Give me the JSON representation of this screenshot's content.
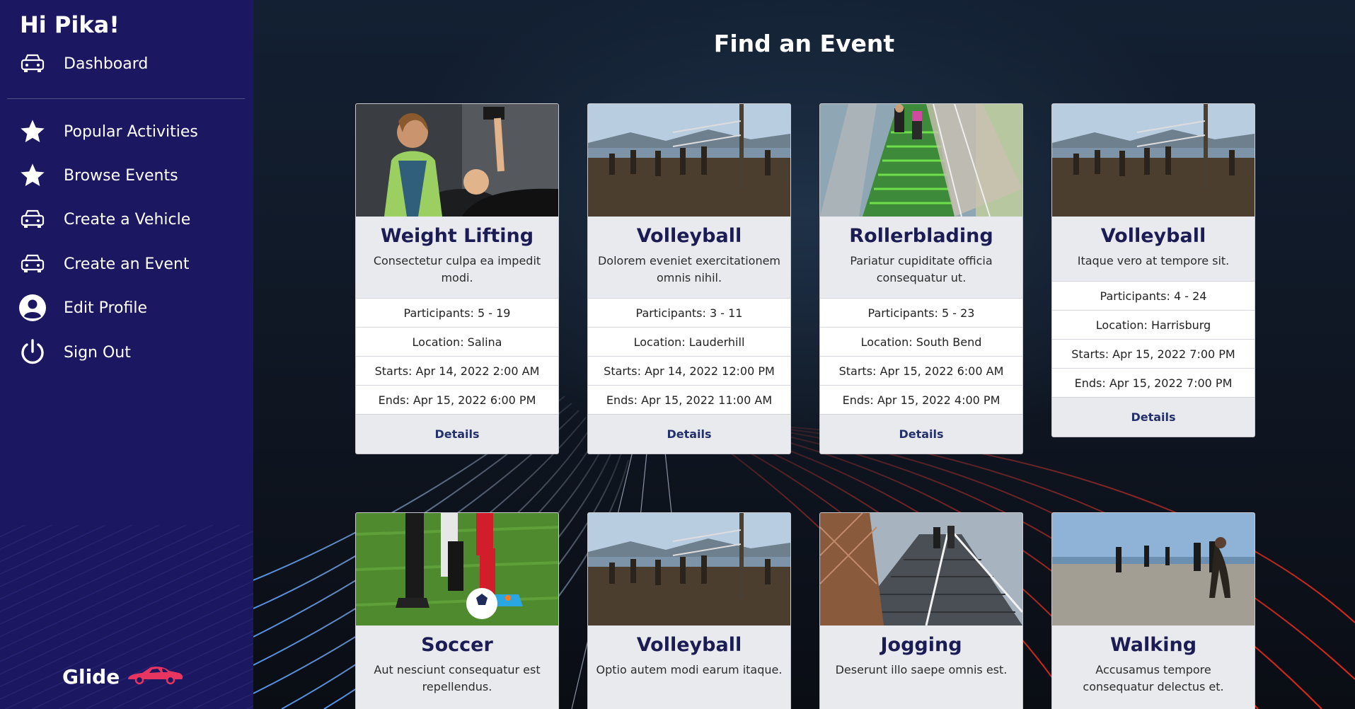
{
  "sidebar": {
    "greeting": "Hi Pika!",
    "items": [
      {
        "label": "Dashboard",
        "icon": "car-icon"
      },
      {
        "label": "Popular Activities",
        "icon": "star-icon"
      },
      {
        "label": "Browse Events",
        "icon": "star-icon"
      },
      {
        "label": "Create a Vehicle",
        "icon": "car-icon"
      },
      {
        "label": "Create an Event",
        "icon": "car-icon"
      },
      {
        "label": "Edit Profile",
        "icon": "user-icon"
      },
      {
        "label": "Sign Out",
        "icon": "power-icon"
      }
    ],
    "brand": "Glide",
    "brand_color": "#e8355f"
  },
  "main": {
    "title": "Find an Event",
    "details_label": "Details",
    "events": [
      {
        "title": "Weight Lifting",
        "description": "Consectetur culpa ea impedit modi.",
        "participants": "Participants: 5 - 19",
        "location": "Location: Salina",
        "starts": "Starts: Apr 14, 2022 2:00 AM",
        "ends": "Ends: Apr 15, 2022 6:00 PM"
      },
      {
        "title": "Volleyball",
        "description": "Dolorem eveniet exercitationem omnis nihil.",
        "participants": "Participants: 3 - 11",
        "location": "Location: Lauderhill",
        "starts": "Starts: Apr 14, 2022 12:00 PM",
        "ends": "Ends: Apr 15, 2022 11:00 AM"
      },
      {
        "title": "Rollerblading",
        "description": "Pariatur cupiditate officia consequatur ut.",
        "participants": "Participants: 5 - 23",
        "location": "Location: South Bend",
        "starts": "Starts: Apr 15, 2022 6:00 AM",
        "ends": "Ends: Apr 15, 2022 4:00 PM"
      },
      {
        "title": "Volleyball",
        "description": "Itaque vero at tempore sit.",
        "participants": "Participants: 4 - 24",
        "location": "Location: Harrisburg",
        "starts": "Starts: Apr 15, 2022 7:00 PM",
        "ends": "Ends: Apr 15, 2022 7:00 PM"
      },
      {
        "title": "Soccer",
        "description": "Aut nesciunt consequatur est repellendus."
      },
      {
        "title": "Volleyball",
        "description": "Optio autem modi earum itaque."
      },
      {
        "title": "Jogging",
        "description": "Deserunt illo saepe omnis est."
      },
      {
        "title": "Walking",
        "description": "Accusamus tempore consequatur delectus et."
      }
    ]
  },
  "colors": {
    "sidebar_bg": "#1b1861",
    "card_title": "#1c1c55",
    "link": "#23306e"
  }
}
